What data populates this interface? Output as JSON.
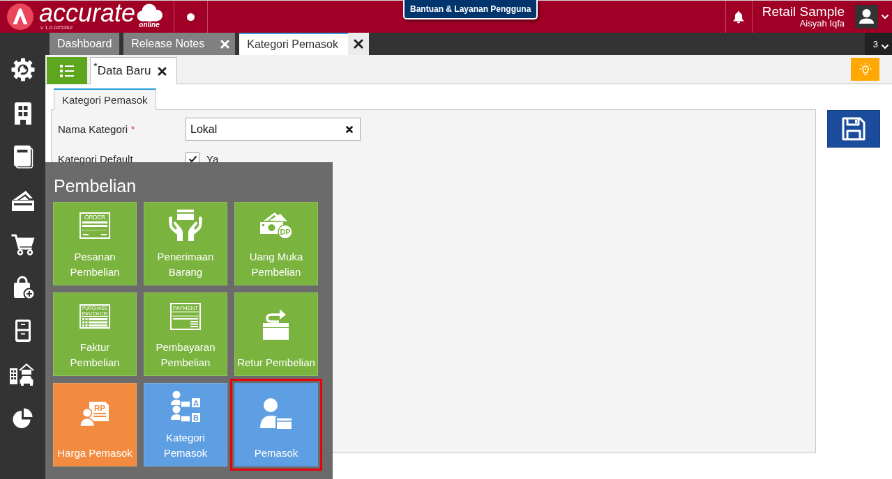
{
  "header": {
    "logo": {
      "wordmark": "accurate",
      "suffix": "online",
      "version": "v 1.0.0#5362"
    },
    "help_button": "Bantuan & Layanan Pengguna",
    "company": "Retail Sample",
    "user": "Aisyah Iqfa"
  },
  "tabs": {
    "items": [
      {
        "label": "Dashboard",
        "selected": false,
        "closable": false
      },
      {
        "label": "Release Notes",
        "selected": false,
        "closable": true
      },
      {
        "label": "Kategori Pemasok",
        "selected": true,
        "closable": true
      }
    ],
    "count": "3"
  },
  "document_tabs": [
    {
      "label": "Data Baru",
      "marker": "*",
      "selected": true,
      "closable": true
    }
  ],
  "form": {
    "tabs": [
      {
        "label": "Kategori Pemasok",
        "selected": true
      }
    ],
    "fields": [
      {
        "kind": "text",
        "label": "Nama Kategori",
        "required_mark": "*",
        "value": "Lokal",
        "clearable": true
      },
      {
        "kind": "checkbox",
        "label": "Kategori Default",
        "checked": true,
        "option": "Ya"
      }
    ]
  },
  "menu": {
    "title": "Pembelian",
    "tiles": [
      {
        "kind": "order",
        "label": "Pesanan Pembelian",
        "color": "#7ab33e",
        "icon_text": [
          "ORDER"
        ],
        "selected": false
      },
      {
        "kind": "receive",
        "label": "Penerimaan Barang",
        "color": "#7ab33e",
        "selected": false
      },
      {
        "kind": "deposit",
        "label": "Uang Muka Pembelian",
        "color": "#7ab33e",
        "icon_text": [
          "DP"
        ],
        "selected": false
      },
      {
        "kind": "invoice",
        "label": "Faktur Pembelian",
        "color": "#7ab33e",
        "icon_text": [
          "PURCHASE",
          "INVOICE"
        ],
        "selected": false
      },
      {
        "kind": "payment",
        "label": "Pembayaran Pembelian",
        "color": "#7ab33e",
        "icon_text": [
          "PAYMENT"
        ],
        "selected": false
      },
      {
        "kind": "return",
        "label": "Retur Pembelian",
        "color": "#7ab33e",
        "selected": false
      },
      {
        "kind": "price",
        "label": "Harga Pemasok",
        "color": "#f28b40",
        "icon_text": [
          "RP"
        ],
        "selected": false
      },
      {
        "kind": "category",
        "label": "Kategori Pemasok",
        "color": "#5e9ee2",
        "icon_text": [
          "A",
          "B"
        ],
        "selected": false
      },
      {
        "kind": "supplier",
        "label": "Pemasok",
        "color": "#5e9ee2",
        "selected": true
      }
    ]
  }
}
